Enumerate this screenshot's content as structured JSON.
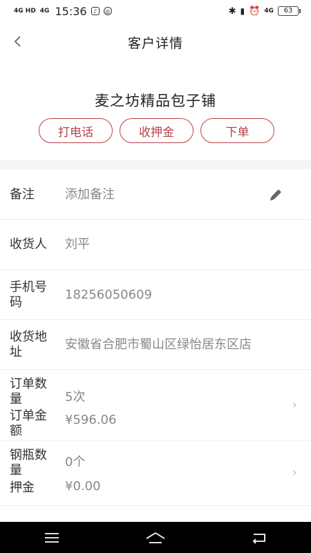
{
  "status_bar": {
    "signal1": "4G HD",
    "signal2": "4G",
    "time": "15:36",
    "network": "4G",
    "battery": "63"
  },
  "nav": {
    "back_icon": "chevron-left-icon",
    "title": "客户详情"
  },
  "customer": {
    "name": "麦之坊精品包子铺"
  },
  "actions": {
    "call": "打电话",
    "deposit": "收押金",
    "order": "下单"
  },
  "details": {
    "note_label": "备注",
    "note_placeholder": "添加备注",
    "receiver_label": "收货人",
    "receiver_value": "刘平",
    "phone_label": "手机号码",
    "phone_value": "18256050609",
    "address_label": "收货地址",
    "address_value": "安徽省合肥市蜀山区绿怡居东区店",
    "order_count_label": "订单数量",
    "order_count_value": "5次",
    "order_amount_label": "订单金额",
    "order_amount_value": "¥596.06",
    "cylinder_count_label": "钢瓶数量",
    "cylinder_count_value": "0个",
    "deposit_label": "押金",
    "deposit_value": "¥0.00"
  },
  "colors": {
    "accent": "#b94046",
    "background": "#f5f5f5"
  }
}
